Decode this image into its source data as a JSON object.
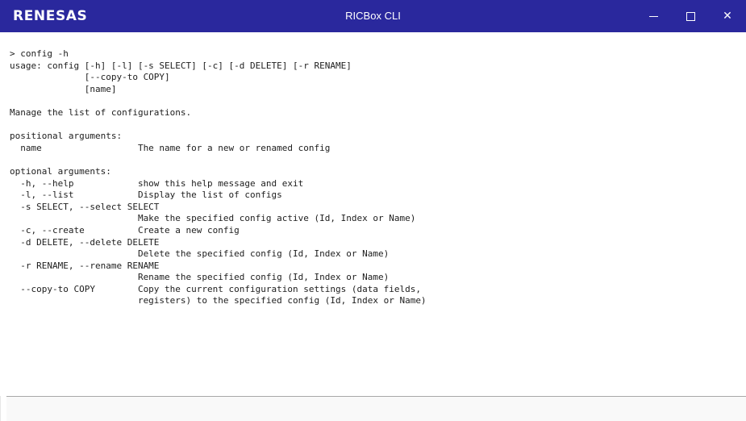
{
  "window": {
    "logo_text": "RENESAS",
    "title": "RICBox CLI",
    "controls": {
      "minimize": "minimize-icon",
      "maximize": "maximize-icon",
      "close": "close-icon",
      "close_glyph": "✕"
    },
    "accent_color": "#2a289d"
  },
  "console": {
    "lines": [
      "> config -h",
      "usage: config [-h] [-l] [-s SELECT] [-c] [-d DELETE] [-r RENAME]",
      "              [--copy-to COPY]",
      "              [name]",
      "",
      "Manage the list of configurations.",
      "",
      "positional arguments:",
      "  name                  The name for a new or renamed config",
      "",
      "optional arguments:",
      "  -h, --help            show this help message and exit",
      "  -l, --list            Display the list of configs",
      "  -s SELECT, --select SELECT",
      "                        Make the specified config active (Id, Index or Name)",
      "  -c, --create          Create a new config",
      "  -d DELETE, --delete DELETE",
      "                        Delete the specified config (Id, Index or Name)",
      "  -r RENAME, --rename RENAME",
      "                        Rename the specified config (Id, Index or Name)",
      "  --copy-to COPY        Copy the current configuration settings (data fields,",
      "                        registers) to the specified config (Id, Index or Name)"
    ]
  },
  "input": {
    "value": ""
  }
}
